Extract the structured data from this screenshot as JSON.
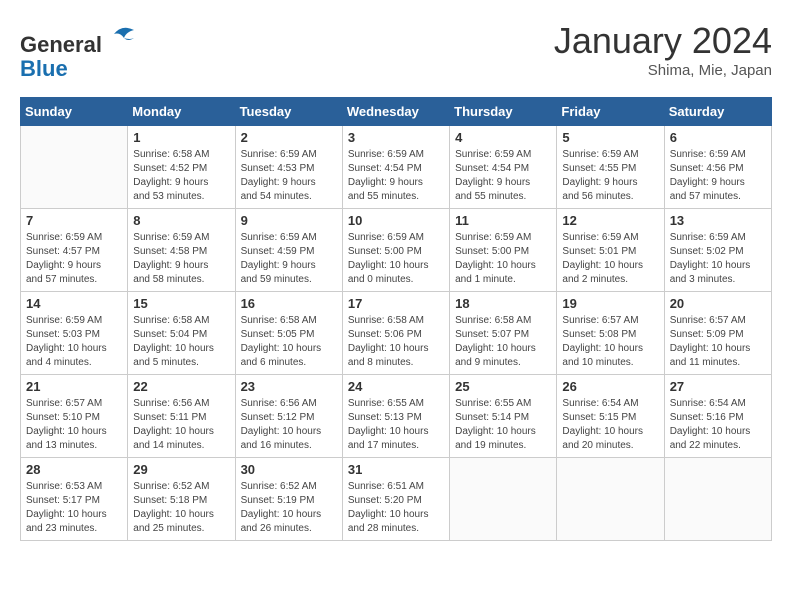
{
  "header": {
    "logo_general": "General",
    "logo_blue": "Blue",
    "month_title": "January 2024",
    "subtitle": "Shima, Mie, Japan"
  },
  "days_of_week": [
    "Sunday",
    "Monday",
    "Tuesday",
    "Wednesday",
    "Thursday",
    "Friday",
    "Saturday"
  ],
  "weeks": [
    [
      {
        "day": "",
        "info": ""
      },
      {
        "day": "1",
        "info": "Sunrise: 6:58 AM\nSunset: 4:52 PM\nDaylight: 9 hours\nand 53 minutes."
      },
      {
        "day": "2",
        "info": "Sunrise: 6:59 AM\nSunset: 4:53 PM\nDaylight: 9 hours\nand 54 minutes."
      },
      {
        "day": "3",
        "info": "Sunrise: 6:59 AM\nSunset: 4:54 PM\nDaylight: 9 hours\nand 55 minutes."
      },
      {
        "day": "4",
        "info": "Sunrise: 6:59 AM\nSunset: 4:54 PM\nDaylight: 9 hours\nand 55 minutes."
      },
      {
        "day": "5",
        "info": "Sunrise: 6:59 AM\nSunset: 4:55 PM\nDaylight: 9 hours\nand 56 minutes."
      },
      {
        "day": "6",
        "info": "Sunrise: 6:59 AM\nSunset: 4:56 PM\nDaylight: 9 hours\nand 57 minutes."
      }
    ],
    [
      {
        "day": "7",
        "info": "Sunrise: 6:59 AM\nSunset: 4:57 PM\nDaylight: 9 hours\nand 57 minutes."
      },
      {
        "day": "8",
        "info": "Sunrise: 6:59 AM\nSunset: 4:58 PM\nDaylight: 9 hours\nand 58 minutes."
      },
      {
        "day": "9",
        "info": "Sunrise: 6:59 AM\nSunset: 4:59 PM\nDaylight: 9 hours\nand 59 minutes."
      },
      {
        "day": "10",
        "info": "Sunrise: 6:59 AM\nSunset: 5:00 PM\nDaylight: 10 hours\nand 0 minutes."
      },
      {
        "day": "11",
        "info": "Sunrise: 6:59 AM\nSunset: 5:00 PM\nDaylight: 10 hours\nand 1 minute."
      },
      {
        "day": "12",
        "info": "Sunrise: 6:59 AM\nSunset: 5:01 PM\nDaylight: 10 hours\nand 2 minutes."
      },
      {
        "day": "13",
        "info": "Sunrise: 6:59 AM\nSunset: 5:02 PM\nDaylight: 10 hours\nand 3 minutes."
      }
    ],
    [
      {
        "day": "14",
        "info": "Sunrise: 6:59 AM\nSunset: 5:03 PM\nDaylight: 10 hours\nand 4 minutes."
      },
      {
        "day": "15",
        "info": "Sunrise: 6:58 AM\nSunset: 5:04 PM\nDaylight: 10 hours\nand 5 minutes."
      },
      {
        "day": "16",
        "info": "Sunrise: 6:58 AM\nSunset: 5:05 PM\nDaylight: 10 hours\nand 6 minutes."
      },
      {
        "day": "17",
        "info": "Sunrise: 6:58 AM\nSunset: 5:06 PM\nDaylight: 10 hours\nand 8 minutes."
      },
      {
        "day": "18",
        "info": "Sunrise: 6:58 AM\nSunset: 5:07 PM\nDaylight: 10 hours\nand 9 minutes."
      },
      {
        "day": "19",
        "info": "Sunrise: 6:57 AM\nSunset: 5:08 PM\nDaylight: 10 hours\nand 10 minutes."
      },
      {
        "day": "20",
        "info": "Sunrise: 6:57 AM\nSunset: 5:09 PM\nDaylight: 10 hours\nand 11 minutes."
      }
    ],
    [
      {
        "day": "21",
        "info": "Sunrise: 6:57 AM\nSunset: 5:10 PM\nDaylight: 10 hours\nand 13 minutes."
      },
      {
        "day": "22",
        "info": "Sunrise: 6:56 AM\nSunset: 5:11 PM\nDaylight: 10 hours\nand 14 minutes."
      },
      {
        "day": "23",
        "info": "Sunrise: 6:56 AM\nSunset: 5:12 PM\nDaylight: 10 hours\nand 16 minutes."
      },
      {
        "day": "24",
        "info": "Sunrise: 6:55 AM\nSunset: 5:13 PM\nDaylight: 10 hours\nand 17 minutes."
      },
      {
        "day": "25",
        "info": "Sunrise: 6:55 AM\nSunset: 5:14 PM\nDaylight: 10 hours\nand 19 minutes."
      },
      {
        "day": "26",
        "info": "Sunrise: 6:54 AM\nSunset: 5:15 PM\nDaylight: 10 hours\nand 20 minutes."
      },
      {
        "day": "27",
        "info": "Sunrise: 6:54 AM\nSunset: 5:16 PM\nDaylight: 10 hours\nand 22 minutes."
      }
    ],
    [
      {
        "day": "28",
        "info": "Sunrise: 6:53 AM\nSunset: 5:17 PM\nDaylight: 10 hours\nand 23 minutes."
      },
      {
        "day": "29",
        "info": "Sunrise: 6:52 AM\nSunset: 5:18 PM\nDaylight: 10 hours\nand 25 minutes."
      },
      {
        "day": "30",
        "info": "Sunrise: 6:52 AM\nSunset: 5:19 PM\nDaylight: 10 hours\nand 26 minutes."
      },
      {
        "day": "31",
        "info": "Sunrise: 6:51 AM\nSunset: 5:20 PM\nDaylight: 10 hours\nand 28 minutes."
      },
      {
        "day": "",
        "info": ""
      },
      {
        "day": "",
        "info": ""
      },
      {
        "day": "",
        "info": ""
      }
    ]
  ]
}
